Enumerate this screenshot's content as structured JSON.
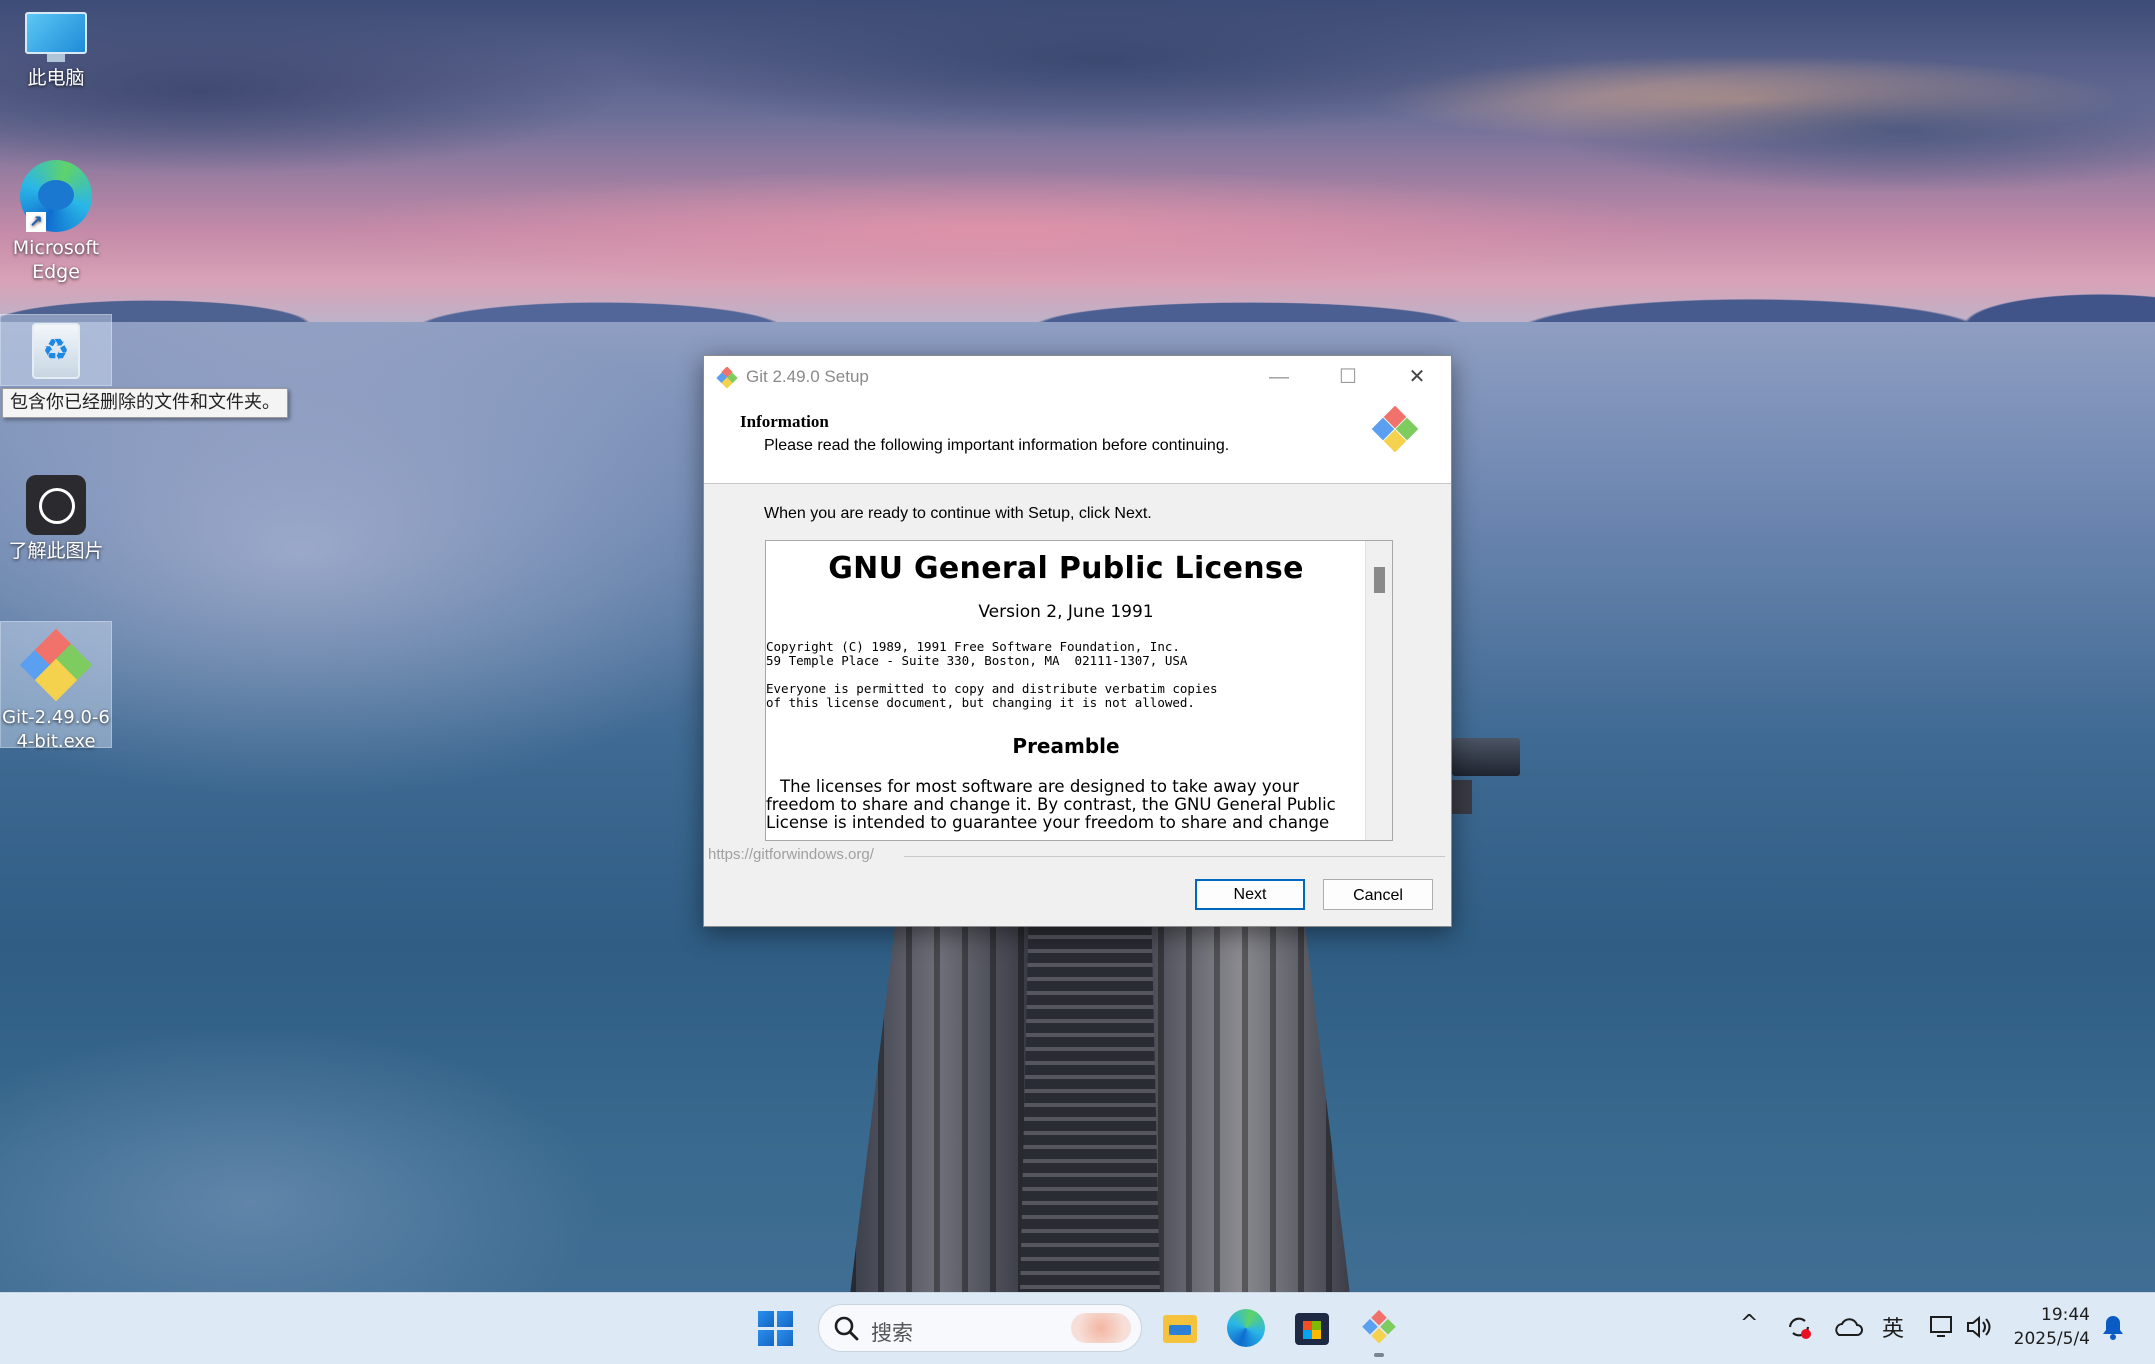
{
  "desktop": {
    "icons": [
      {
        "label": "此电脑",
        "icon": "this-pc-icon"
      },
      {
        "label": "Microsoft Edge",
        "icon": "edge-icon"
      },
      {
        "label": "回收站",
        "icon": "recycle-bin-icon"
      },
      {
        "label": "了解此图片",
        "icon": "spotlight-icon"
      },
      {
        "label": "Git-2.49.0-64-bit.exe",
        "icon": "git-installer-icon"
      }
    ],
    "tooltip": "包含你已经删除的文件和文件夹。"
  },
  "dialog": {
    "title": "Git 2.49.0 Setup",
    "header_title": "Information",
    "header_subtitle": "Please read the following important information before continuing.",
    "intro": "When you are ready to continue with Setup, click Next.",
    "license": {
      "heading": "GNU General Public License",
      "version": "Version 2, June 1991",
      "copyright": "Copyright (C) 1989, 1991 Free Software Foundation, Inc.\n59 Temple Place - Suite 330, Boston, MA  02111-1307, USA",
      "permission": "Everyone is permitted to copy and distribute verbatim copies\nof this license document, but changing it is not allowed.",
      "preamble_heading": "Preamble",
      "preamble_text": "The licenses for most software are designed to take away your freedom to share and change it. By contrast, the GNU General Public License is intended to guarantee your freedom to share and change"
    },
    "link": "https://gitforwindows.org/",
    "buttons": {
      "next": "Next",
      "cancel": "Cancel"
    },
    "controls": {
      "minimize": "—",
      "maximize": "☐",
      "close": "✕"
    }
  },
  "taskbar": {
    "search_placeholder": "搜索",
    "pinned": [
      "start-icon",
      "file-explorer-icon",
      "edge-icon",
      "microsoft-store-icon",
      "git-icon"
    ],
    "tray": {
      "overflow": "^",
      "ime": "英",
      "time": "19:44",
      "date": "2025/5/4"
    }
  },
  "colors": {
    "accent": "#0067c0",
    "taskbar": "#dde9f5",
    "dialog_bg": "#f0f0f0"
  }
}
